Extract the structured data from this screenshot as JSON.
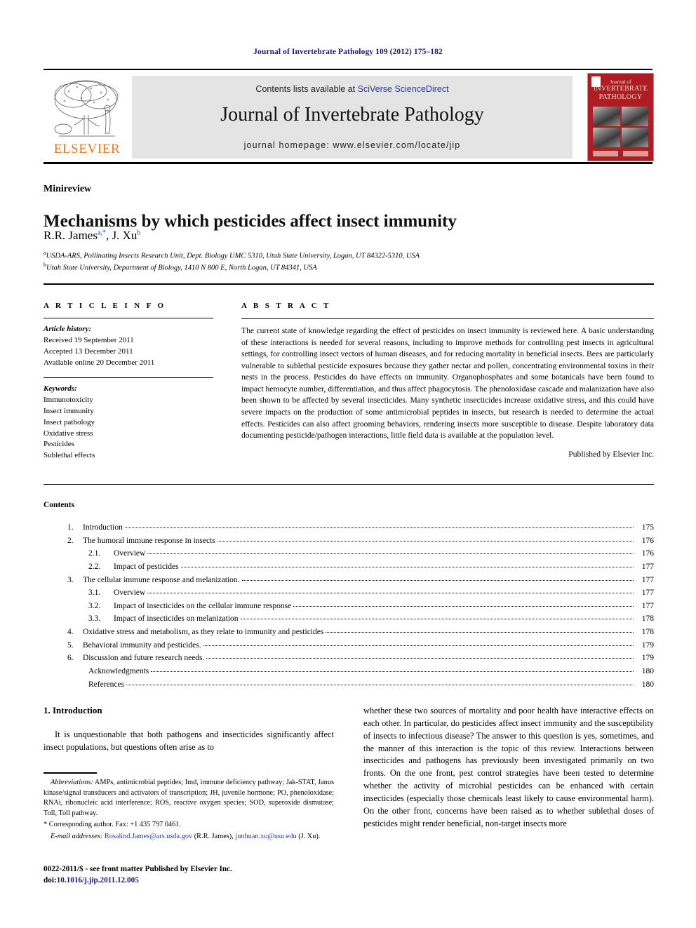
{
  "running_head": "Journal of Invertebrate Pathology 109 (2012) 175–182",
  "masthead": {
    "publisher_wordmark": "ELSEVIER",
    "contents_prefix": "Contents lists available at ",
    "contents_link": "SciVerse ScienceDirect",
    "journal_title": "Journal of Invertebrate Pathology",
    "homepage": "journal homepage: www.elsevier.com/locate/jip",
    "cover": {
      "line1": "Journal of",
      "line2": "INVERTEBRATE",
      "line3": "PATHOLOGY",
      "color": "#b01c24"
    }
  },
  "article": {
    "doctype": "Minireview",
    "title": "Mechanisms by which pesticides affect insect immunity",
    "authors_plain": "R.R. James a,*, J. Xu b",
    "authors": [
      {
        "name": "R.R. James",
        "marks": "a,*"
      },
      {
        "name": "J. Xu",
        "marks": "b"
      }
    ],
    "affiliations": [
      {
        "mark": "a",
        "text": "USDA-ARS, Pollinating Insects Research Unit, Dept. Biology UMC 5310, Utah State University, Logan, UT 84322-5310, USA"
      },
      {
        "mark": "b",
        "text": "Utah State University, Department of Biology, 1410 N 800 E, North Logan, UT 84341, USA"
      }
    ]
  },
  "info": {
    "heading": "A R T I C L E   I N F O",
    "history_label": "Article history:",
    "history": [
      "Received 19 September 2011",
      "Accepted 13 December 2011",
      "Available online 20 December 2011"
    ],
    "keywords_label": "Keywords:",
    "keywords": [
      "Immunotoxicity",
      "Insect immunity",
      "Insect pathology",
      "Oxidative stress",
      "Pesticides",
      "Sublethal effects"
    ]
  },
  "abstract": {
    "heading": "A B S T R A C T",
    "text": "The current state of knowledge regarding the effect of pesticides on insect immunity is reviewed here. A basic understanding of these interactions is needed for several reasons, including to improve methods for controlling pest insects in agricultural settings, for controlling insect vectors of human diseases, and for reducing mortality in beneficial insects. Bees are particularly vulnerable to sublethal pesticide exposures because they gather nectar and pollen, concentrating environmental toxins in their nests in the process. Pesticides do have effects on immunity. Organophosphates and some botanicals have been found to impact hemocyte number, differentiation, and thus affect phagocytosis. The phenoloxidase cascade and malanization have also been shown to be affected by several insecticides. Many synthetic insecticides increase oxidative stress, and this could have severe impacts on the production of some antimicrobial peptides in insects, but research is needed to determine the actual effects. Pesticides can also affect grooming behaviors, rendering insects more susceptible to disease. Despite laboratory data documenting pesticide/pathogen interactions, little field data is available at the population level.",
    "publisher_line": "Published by Elsevier Inc."
  },
  "contents": {
    "heading": "Contents",
    "entries": [
      {
        "num": "1.",
        "label": "Introduction",
        "page": "175",
        "level": 1
      },
      {
        "num": "2.",
        "label": "The humoral immune response in insects",
        "page": "176",
        "level": 1
      },
      {
        "num": "2.1.",
        "label": "Overview",
        "page": "176",
        "level": 2
      },
      {
        "num": "2.2.",
        "label": "Impact of pesticides",
        "page": "177",
        "level": 2
      },
      {
        "num": "3.",
        "label": "The cellular immune response and melanization.",
        "page": "177",
        "level": 1
      },
      {
        "num": "3.1.",
        "label": "Overview",
        "page": "177",
        "level": 2
      },
      {
        "num": "3.2.",
        "label": "Impact of insecticides on the cellular immune response",
        "page": "177",
        "level": 2
      },
      {
        "num": "3.3.",
        "label": "Impact of insecticides on melanization",
        "page": "178",
        "level": 2
      },
      {
        "num": "4.",
        "label": "Oxidative stress and metabolism, as they relate to immunity and pesticides",
        "page": "178",
        "level": 1
      },
      {
        "num": "5.",
        "label": "Behavioral immunity and pesticides.",
        "page": "179",
        "level": 1
      },
      {
        "num": "6.",
        "label": "Discussion and future research needs.",
        "page": "179",
        "level": 1
      },
      {
        "num": "",
        "label": "Acknowledgments",
        "page": "180",
        "level": 0
      },
      {
        "num": "",
        "label": "References",
        "page": "180",
        "level": 0
      }
    ]
  },
  "body": {
    "section_heading": "1. Introduction",
    "left_paragraph": "It is unquestionable that both pathogens and insecticides significantly affect insect populations, but questions often arise as to",
    "right_paragraph": "whether these two sources of mortality and poor health have interactive effects on each other. In particular, do pesticides affect insect immunity and the susceptibility of insects to infectious disease? The answer to this question is yes, sometimes, and the manner of this interaction is the topic of this review. Interactions between insecticides and pathogens has previously been investigated primarily on two fronts. On the one front, pest control strategies have been tested to determine whether the activity of microbial pesticides can be enhanced with certain insecticides (especially those chemicals least likely to cause environmental harm). On the other front, concerns have been raised as to whether sublethal doses of pesticides might render beneficial, non-target insects more"
  },
  "footnotes": {
    "abbreviations_label": "Abbreviations:",
    "abbreviations_text": " AMPs, antimicrobial peptides; Imd, immune deficiency pathway; Jak-STAT, Janus kinase/signal transducers and activators of transcription; JH, juvenile hormone; PO, phenoloxidase; RNAi, ribonucleic acid interference; ROS, reactive oxygen species; SOD, superoxide dismutase; Toll, Toll pathway.",
    "corresponding": "* Corresponding author. Fax: +1 435 797 0461.",
    "email_label": "E-mail addresses:",
    "email_1": "Rosalind.James@ars.usda.gov",
    "email_1_owner": " (R.R. James), ",
    "email_2": "junhuan.xu@usu.edu",
    "email_2_owner": " (J. Xu)."
  },
  "colophon": {
    "issn_line": "0022-2011/$ - see front matter Published by Elsevier Inc.",
    "doi_label": "doi:",
    "doi_value": "10.1016/j.jip.2011.12.005"
  }
}
